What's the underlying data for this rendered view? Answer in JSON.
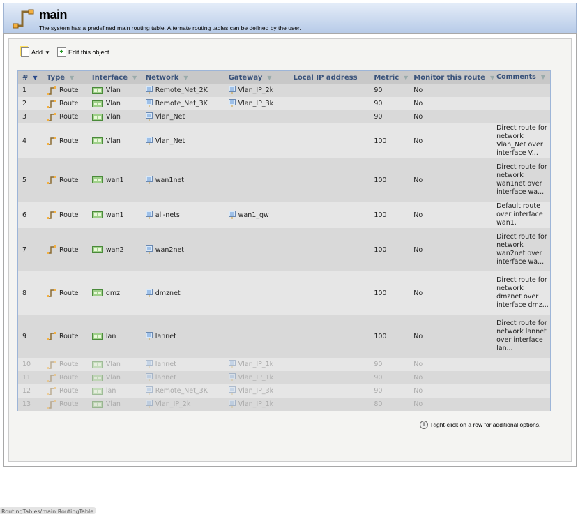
{
  "header": {
    "title": "main",
    "description": "The system has a predefined main routing table. Alternate routing tables can be defined by the user."
  },
  "toolbar": {
    "add_label": "Add",
    "edit_label": "Edit this object"
  },
  "table": {
    "columns": [
      "#",
      "Type",
      "Interface",
      "Network",
      "Gateway",
      "Local IP address",
      "Metric",
      "Monitor this route",
      "Comments"
    ],
    "rows": [
      {
        "n": "1",
        "type": "Route",
        "iface": "Vlan",
        "network": "Remote_Net_2K",
        "gateway": "Vlan_IP_2k",
        "local": "",
        "metric": "90",
        "monitor": "No",
        "comment": "",
        "disabled": false
      },
      {
        "n": "2",
        "type": "Route",
        "iface": "Vlan",
        "network": "Remote_Net_3K",
        "gateway": "Vlan_IP_3k",
        "local": "",
        "metric": "90",
        "monitor": "No",
        "comment": "",
        "disabled": false
      },
      {
        "n": "3",
        "type": "Route",
        "iface": "Vlan",
        "network": "Vlan_Net",
        "gateway": "",
        "local": "",
        "metric": "90",
        "monitor": "No",
        "comment": "",
        "disabled": false
      },
      {
        "n": "4",
        "type": "Route",
        "iface": "Vlan",
        "network": "Vlan_Net",
        "gateway": "",
        "local": "",
        "metric": "100",
        "monitor": "No",
        "comment": "Direct route for network Vlan_Net over interface V...",
        "disabled": false
      },
      {
        "n": "5",
        "type": "Route",
        "iface": "wan1",
        "network": "wan1net",
        "gateway": "",
        "local": "",
        "metric": "100",
        "monitor": "No",
        "comment": "Direct route for network wan1net over interface wa...",
        "disabled": false
      },
      {
        "n": "6",
        "type": "Route",
        "iface": "wan1",
        "network": "all-nets",
        "gateway": "wan1_gw",
        "local": "",
        "metric": "100",
        "monitor": "No",
        "comment": "Default route over interface wan1.",
        "disabled": false
      },
      {
        "n": "7",
        "type": "Route",
        "iface": "wan2",
        "network": "wan2net",
        "gateway": "",
        "local": "",
        "metric": "100",
        "monitor": "No",
        "comment": "Direct route for network wan2net over interface wa...",
        "disabled": false
      },
      {
        "n": "8",
        "type": "Route",
        "iface": "dmz",
        "network": "dmznet",
        "gateway": "",
        "local": "",
        "metric": "100",
        "monitor": "No",
        "comment": "Direct route for network dmznet over interface dmz...",
        "disabled": false
      },
      {
        "n": "9",
        "type": "Route",
        "iface": "lan",
        "network": "lannet",
        "gateway": "",
        "local": "",
        "metric": "100",
        "monitor": "No",
        "comment": "Direct route for network lannet over interface lan...",
        "disabled": false
      },
      {
        "n": "10",
        "type": "Route",
        "iface": "Vlan",
        "network": "lannet",
        "gateway": "Vlan_IP_1k",
        "local": "",
        "metric": "90",
        "monitor": "No",
        "comment": "",
        "disabled": true
      },
      {
        "n": "11",
        "type": "Route",
        "iface": "Vlan",
        "network": "lannet",
        "gateway": "Vlan_IP_1k",
        "local": "",
        "metric": "90",
        "monitor": "No",
        "comment": "",
        "disabled": true
      },
      {
        "n": "12",
        "type": "Route",
        "iface": "lan",
        "network": "Remote_Net_3K",
        "gateway": "Vlan_IP_3k",
        "local": "",
        "metric": "90",
        "monitor": "No",
        "comment": "",
        "disabled": true
      },
      {
        "n": "13",
        "type": "Route",
        "iface": "Vlan",
        "network": "Vlan_IP_2k",
        "gateway": "Vlan_IP_1k",
        "local": "",
        "metric": "80",
        "monitor": "No",
        "comment": "",
        "disabled": true
      }
    ]
  },
  "hint": "Right-click on a row for additional options.",
  "footer": {
    "path": "RoutingTables/main RoutingTable"
  }
}
